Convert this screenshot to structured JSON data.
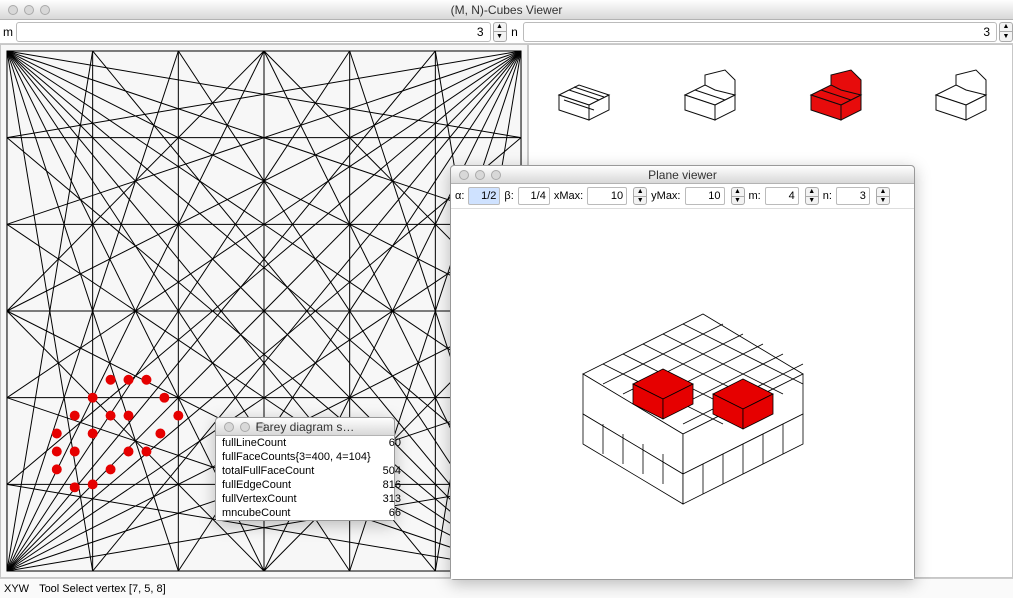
{
  "window": {
    "title": "(M, N)-Cubes Viewer"
  },
  "toolbar": {
    "m_label": "m",
    "m_value": "3",
    "n_label": "n",
    "n_value": "3"
  },
  "status": {
    "xyw": "XYW",
    "tool": "Tool Select vertex [7, 5, 8]"
  },
  "farey_stats_panel": {
    "title": "Farey diagram s…",
    "rows": [
      {
        "label": "fullLineCount",
        "value": "60"
      },
      {
        "label": "fullFaceCounts{3=400, 4=104}",
        "value": ""
      },
      {
        "label": "totalFullFaceCount",
        "value": "504"
      },
      {
        "label": "fullEdgeCount",
        "value": "816"
      },
      {
        "label": "fullVertexCount",
        "value": "313"
      },
      {
        "label": "mncubeCount",
        "value": "66"
      }
    ]
  },
  "plane_viewer": {
    "title": "Plane viewer",
    "alpha_label": "α:",
    "alpha_value": "1/2",
    "beta_label": "β:",
    "beta_value": "1/4",
    "xmax_label": "xMax:",
    "xmax_value": "10",
    "ymax_label": "yMax:",
    "ymax_value": "10",
    "m_label": "m:",
    "m_value": "4",
    "n_label": "n:",
    "n_value": "3"
  }
}
